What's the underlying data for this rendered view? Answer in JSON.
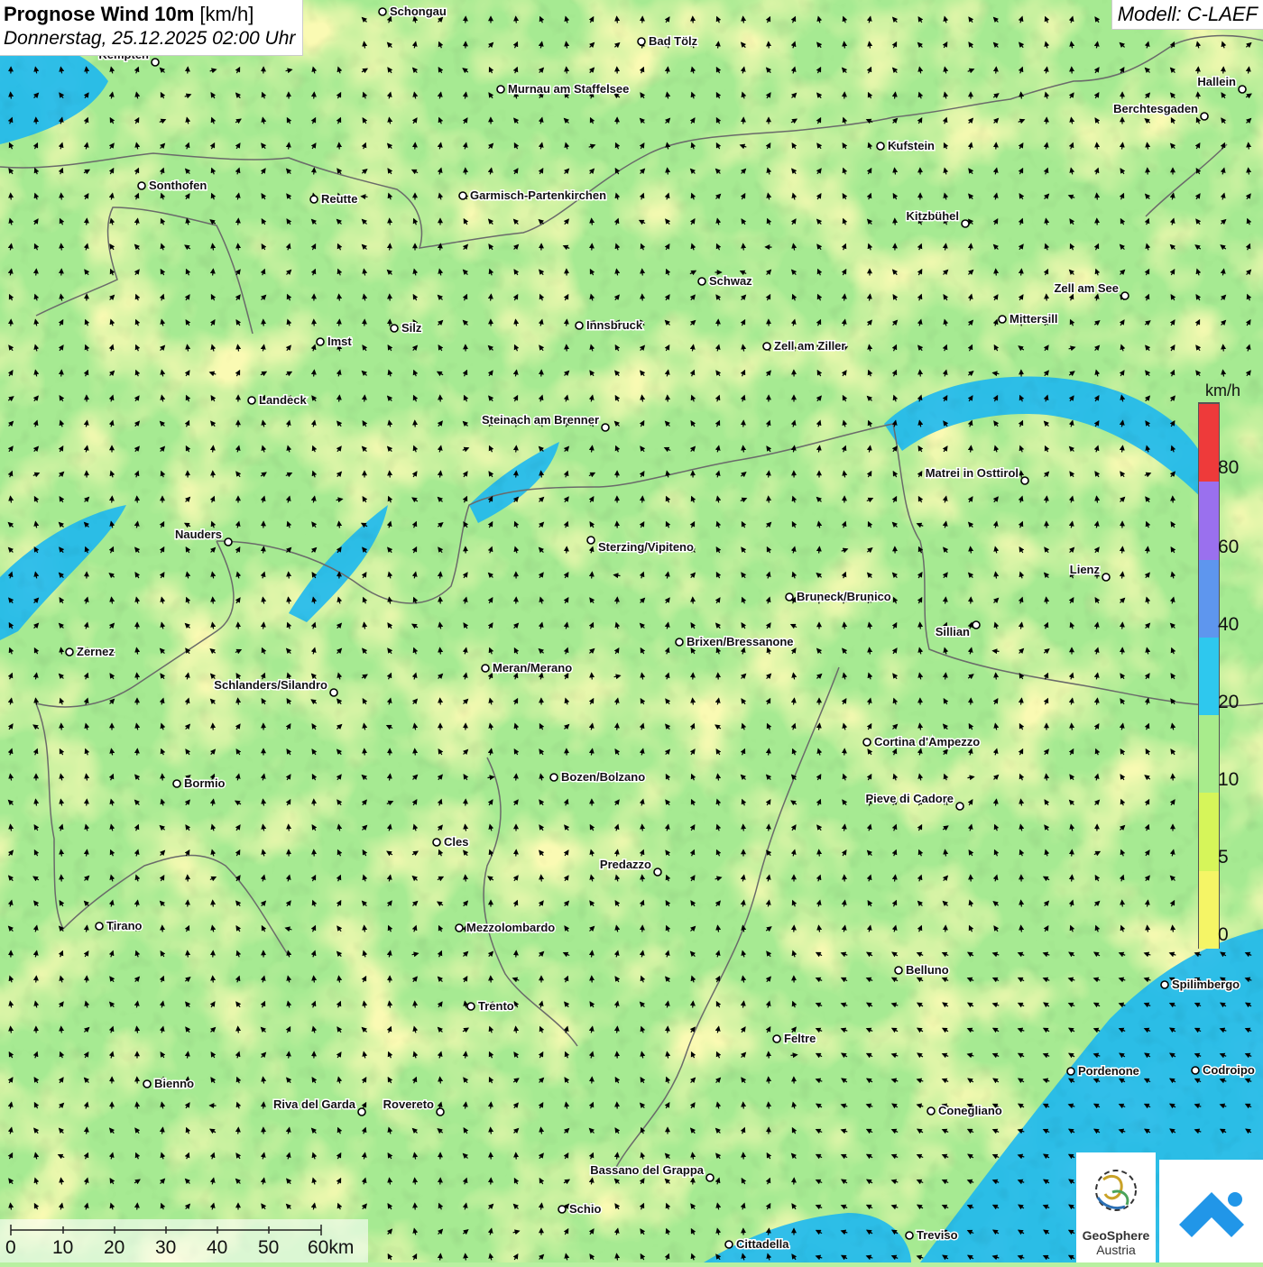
{
  "title": {
    "main_bold": "Prognose Wind 10m",
    "unit": "[km/h]",
    "datetime": "Donnerstag, 25.12.2025 02:00 Uhr"
  },
  "model_label": "Modell: C-LAEF",
  "legend": {
    "unit": "km/h",
    "ticks": [
      "0",
      "5",
      "10",
      "20",
      "40",
      "60",
      "80"
    ],
    "colors": [
      "#f5f566",
      "#d6f55a",
      "#a8ec8c",
      "#2ec8ee",
      "#5e96ee",
      "#9a70ee",
      "#ee3a3a"
    ]
  },
  "colors": {
    "calm": "#f6f57a",
    "light": "#a6ea92",
    "moderate": "#1eb8f0",
    "border": "#6a6a6a",
    "city_dot": "#ffffff"
  },
  "cities": [
    "Schongau",
    "Bad Tölz",
    "Kempten",
    "Murnau am Staffelsee",
    "Hallein",
    "Berchtesgaden",
    "Kufstein",
    "Sonthofen",
    "Reutte",
    "Garmisch-Partenkirchen",
    "Kitzbühel",
    "Schwaz",
    "Zell am See",
    "Mittersill",
    "Innsbruck",
    "Silz",
    "Imst",
    "Zell am Ziller",
    "Landeck",
    "Steinach am Brenner",
    "Matrei in Osttirol",
    "Nauders",
    "Sterzing/Vipiteno",
    "Lienz",
    "Bruneck/Brunico",
    "Sillian",
    "Zernez",
    "Brixen/Bressanone",
    "Meran/Merano",
    "Schlanders/Silandro",
    "Cortina d'Ampezzo",
    "Bozen/Bolzano",
    "Bormio",
    "Pieve di Cadore",
    "Cles",
    "Predazzo",
    "Tirano",
    "Mezzolombardo",
    "Belluno",
    "Spilimbergo",
    "Trento",
    "Feltre",
    "Pordenone",
    "Codroipo",
    "Bienno",
    "Riva del Garda",
    "Rovereto",
    "Conegliano",
    "Bassano del Grappa",
    "Schio",
    "Treviso",
    "Cittadella"
  ],
  "scale_bar": {
    "labels": [
      "0",
      "10",
      "20",
      "30",
      "40",
      "50",
      "60km"
    ]
  },
  "logos": {
    "geosphere_line1": "GeoSphere",
    "geosphere_line2": "Austria"
  }
}
